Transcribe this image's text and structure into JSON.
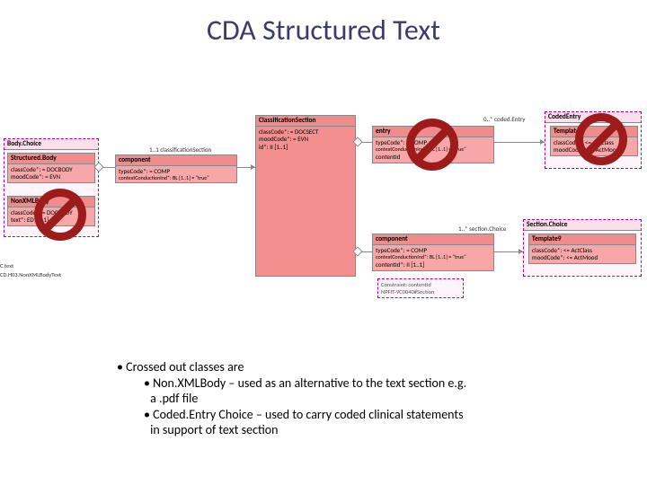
{
  "title": "CDA Structured Text",
  "boxes": {
    "bodychoice": {
      "header": "Body.Choice"
    },
    "structuredbody": {
      "header": "Structured.Body",
      "line1": "classCode*: = DOCBODY",
      "line2": "moodCode*: = EVN"
    },
    "nonxmlbody": {
      "header": "NonXMLBody",
      "line1": "classCode*: = DOCBODY",
      "line2": "text*: ED [1..1]"
    },
    "component1": {
      "header": "component",
      "line1": "typeCode*: = COMP",
      "line2": "contextConductionInd*: BL [1..1] = \"true\""
    },
    "classification": {
      "header": "ClassificationSection",
      "line1": "classCode*: = DOCSECT",
      "line2": "moodCode*: = EVN",
      "line3": "id*: II [1..1]"
    },
    "entry": {
      "header": "entry",
      "line1": "typeCode*: = COMP",
      "line2": "contextConductionInd*: BL [1..1] = \"true\"",
      "line3": "contentId"
    },
    "codedentry": {
      "header": "CodedEntry"
    },
    "template1": {
      "header": "Template1",
      "line1": "classCode*: <= ActClass",
      "line2": "moodCode*: <= ActMood"
    },
    "component2": {
      "header": "component",
      "line1": "typeCode*: = COMP",
      "line2": "contextConductionInd*: BL [1..1] = \"true\"",
      "line3": "contentId*: II [1..1]"
    },
    "sectionchoice": {
      "header": "Section.Choice"
    },
    "template9": {
      "header": "Template9",
      "line1": "classCode*: <= ActClass",
      "line2": "moodCode*: <= ActMood"
    }
  },
  "labels": {
    "class_sect": "1..1 classificationSection",
    "coded_entry_mult": "0..* coded.Entry",
    "sect_choice_mult": "1..* section.Choice",
    "ctext": "C.text",
    "cdid": "CD.H03.NonXMLBodyText",
    "constraint_hdr": "Constraint: contentId",
    "constraint_body": "NPFIT-9C0040#Section"
  },
  "notes": {
    "n1": "Crossed out classes are",
    "n2a": "Non.XMLBody – used as an alternative to the text section e.g.",
    "n2b": "a .pdf file",
    "n3a": "Coded.Entry Choice – used to carry coded clinical statements",
    "n3b": "in support of text section"
  }
}
